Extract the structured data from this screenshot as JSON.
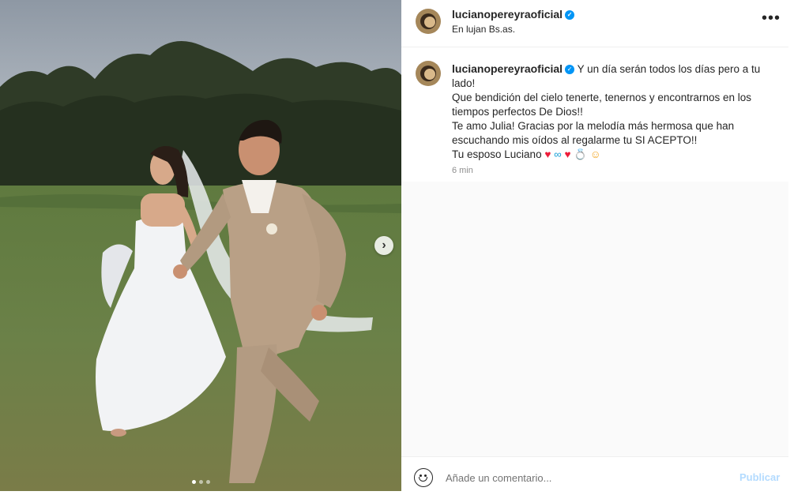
{
  "post": {
    "username": "lucianopereyraoficial",
    "verified_icon": "verified-badge-icon",
    "location": "En lujan Bs.as.",
    "more_icon": "more-options-icon",
    "more_glyph": "•••"
  },
  "caption": {
    "username": "lucianopereyraoficial",
    "line1": "Y un día serán todos los días pero a tu lado!",
    "line2": "Que bendición del cielo tenerte, tenernos y encontrarnos en los tiempos perfectos De Dios!!",
    "line3": "Te amo Julia! Gracias por la melodía más hermosa que han escuchando mis oídos al regalarme tu SI ACEPTO!!",
    "line4": "Tu esposo Luciano",
    "emojis": [
      "red-heart",
      "infinity",
      "red-heart",
      "ring",
      "smiling-face"
    ],
    "time": "6 min"
  },
  "carousel": {
    "next_icon": "chevron-right-icon",
    "next_glyph": "›",
    "slides": 3,
    "active_slide": 1
  },
  "comment": {
    "placeholder": "Añade un comentario...",
    "value": "",
    "publish_label": "Publicar"
  },
  "colors": {
    "accent": "#0095f6",
    "publish_disabled": "#b3dbff",
    "heart": "#ed1c39"
  }
}
